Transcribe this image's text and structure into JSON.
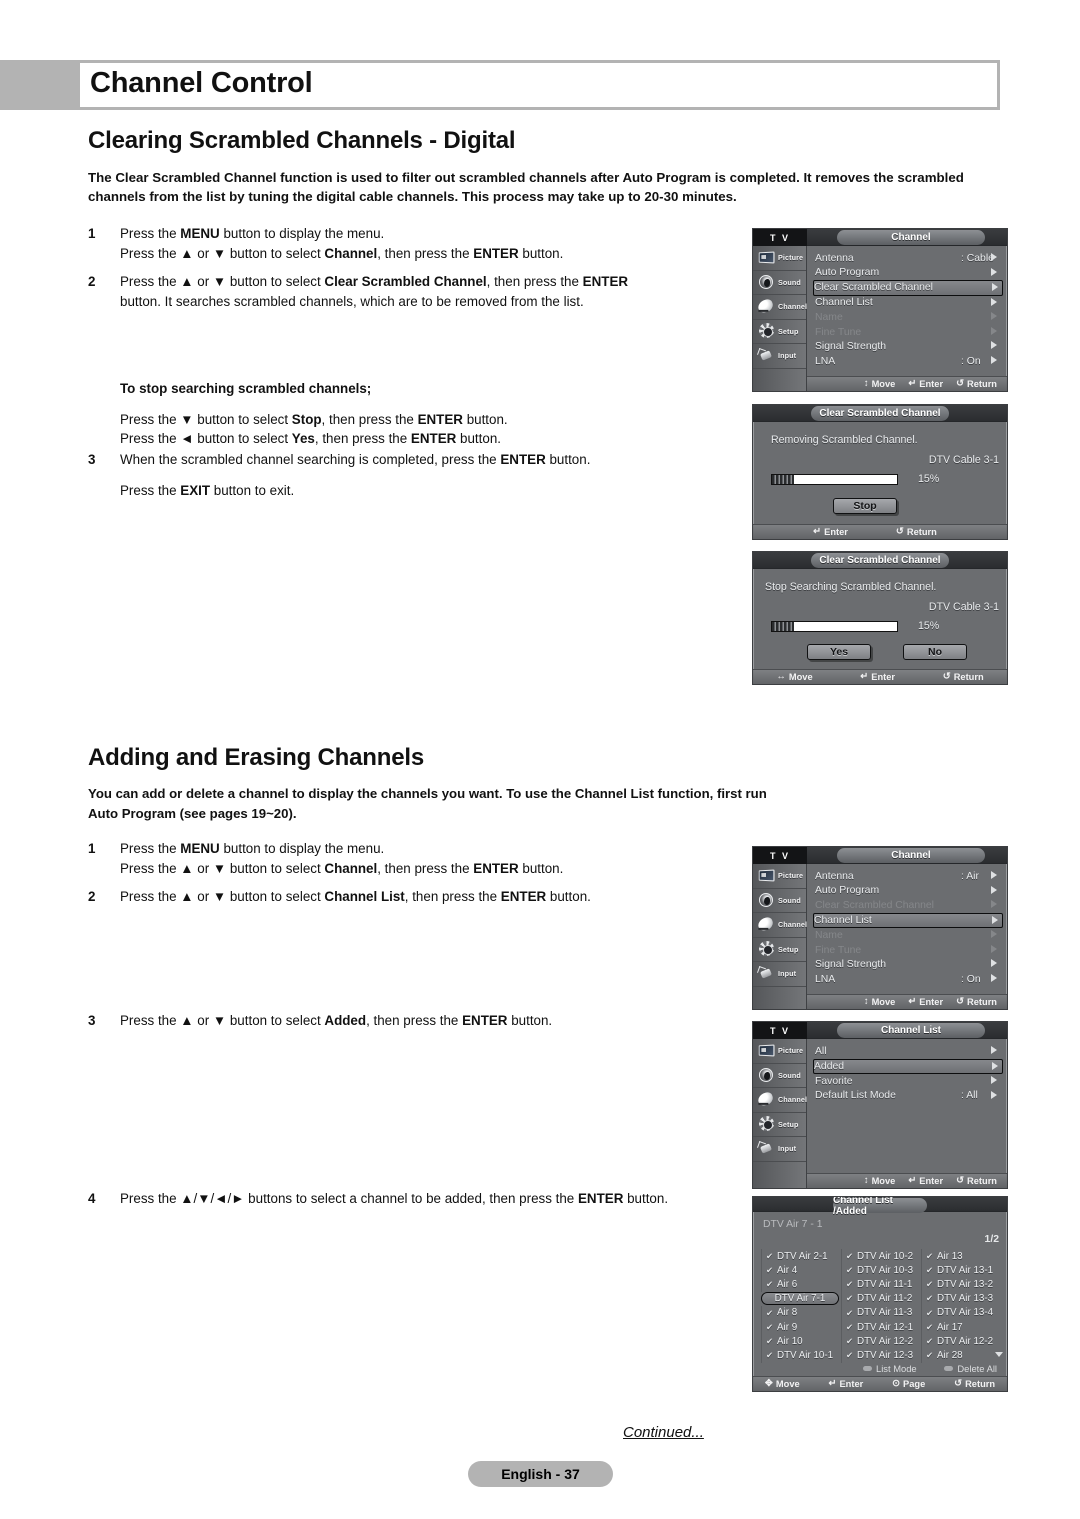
{
  "header": {
    "title": "Channel Control"
  },
  "section1": {
    "heading": "Clearing Scrambled Channels - Digital",
    "intro_line1": "The Clear Scrambled Channel function is used to filter out scrambled channels after Auto Program is completed. It removes the",
    "intro_line2": "scrambled channels from the list by tuning the digital cable channels. This process may take up to 20-30 minutes.",
    "steps": [
      {
        "num": "1",
        "line1_a": "Press the ",
        "line1_b": "MENU",
        "line1_c": " button to display the menu.",
        "line2_a": "Press the ▲ or ▼ button to select ",
        "line2_b": "Channel",
        "line2_c": ", then press the ",
        "line2_d": "ENTER",
        "line2_e": " button."
      },
      {
        "num": "2",
        "line1_a": "Press the ▲ or ▼ button to select ",
        "line1_b": "Clear Scrambled Channel",
        "line1_c": ", then press the ",
        "line1_d": "ENTER",
        "line2_a": "button. It searches scrambled channels, which are to be removed from the list."
      }
    ],
    "substep": {
      "heading": "To stop searching scrambled channels;",
      "line1_a": "Press the ▼ button to select ",
      "line1_b": "Stop",
      "line1_c": ", then press the ",
      "line1_d": "ENTER",
      "line1_e": " button.",
      "line2_a": "Press the ◄ button to select ",
      "line2_b": "Yes",
      "line2_c": ", then press the  ",
      "line2_d": "ENTER",
      "line2_e": " button."
    },
    "step3": {
      "num": "3",
      "a": "When the scrambled channel searching is completed, press the ",
      "b": "ENTER",
      "c": " button."
    },
    "exit": {
      "a": "Press the ",
      "b": "EXIT",
      "c": " button to exit."
    }
  },
  "section2": {
    "heading": "Adding and Erasing Channels",
    "intro_line1": "You can add or delete a channel to display the channels you want.",
    "intro_line2": "To use the Channel List function, first run Auto Program (see pages 19~20).",
    "steps": [
      {
        "num": "1",
        "line1_a": "Press the ",
        "line1_b": "MENU",
        "line1_c": " button to display the menu.",
        "line2_a": "Press the ▲ or ▼ button to select ",
        "line2_b": "Channel",
        "line2_c": ", then press the ",
        "line2_d": "ENTER",
        "line2_e": " button."
      },
      {
        "num": "2",
        "line1_a": "Press the ▲ or ▼ button to select ",
        "line1_b": "Channel List",
        "line1_c": ", then press the ",
        "line1_d": "ENTER",
        "line1_e": " button."
      },
      {
        "num": "3",
        "line1_a": "Press the ▲ or ▼ button to select ",
        "line1_b": "Added",
        "line1_c": ", then press the ",
        "line1_d": "ENTER",
        "line1_e": " button."
      },
      {
        "num": "4",
        "line1_a": "Press the ▲/▼/◄/► buttons to select a channel to be added, then press the ",
        "line1_b": "ENTER",
        "line1_c": " button."
      }
    ]
  },
  "footer": {
    "continued": "Continued...",
    "page": "English - 37"
  },
  "osd_common": {
    "tv_tab": "T V",
    "sidebar": [
      {
        "label": "Picture",
        "icon": "tv-picture-icon"
      },
      {
        "label": "Sound",
        "icon": "speaker-sound-icon"
      },
      {
        "label": "Channel",
        "icon": "satellite-dish-icon"
      },
      {
        "label": "Setup",
        "icon": "gear-setup-icon"
      },
      {
        "label": "Input",
        "icon": "plug-input-icon"
      }
    ],
    "foot_move": "Move",
    "foot_enter": "Enter",
    "foot_return": "Return",
    "foot_page": "Page"
  },
  "osd_channel_cable": {
    "title": "Channel",
    "rows": [
      {
        "label": "Antenna",
        "value": ": Cable",
        "state": "normal"
      },
      {
        "label": "Auto Program",
        "value": "",
        "state": "normal"
      },
      {
        "label": "Clear Scrambled Channel",
        "value": "",
        "state": "selected"
      },
      {
        "label": "Channel List",
        "value": "",
        "state": "normal"
      },
      {
        "label": "Name",
        "value": "",
        "state": "dim"
      },
      {
        "label": "Fine Tune",
        "value": "",
        "state": "dim"
      },
      {
        "label": "Signal Strength",
        "value": "",
        "state": "normal"
      },
      {
        "label": "LNA",
        "value": ": On",
        "state": "normal"
      }
    ]
  },
  "osd_removing": {
    "title": "Clear Scrambled Channel",
    "message": "Removing Scrambled Channel.",
    "channel": "DTV Cable 3-1",
    "percent": "15%",
    "progress": 15,
    "button": "Stop"
  },
  "osd_stop_search": {
    "title": "Clear Scrambled Channel",
    "message": "Stop Searching Scrambled Channel.",
    "channel": "DTV Cable 3-1",
    "percent": "15%",
    "progress": 15,
    "yes": "Yes",
    "no": "No"
  },
  "osd_channel_air": {
    "title": "Channel",
    "rows": [
      {
        "label": "Antenna",
        "value": ": Air",
        "state": "normal"
      },
      {
        "label": "Auto Program",
        "value": "",
        "state": "normal"
      },
      {
        "label": "Clear Scrambled Channel",
        "value": "",
        "state": "dim"
      },
      {
        "label": "Channel List",
        "value": "",
        "state": "selected"
      },
      {
        "label": "Name",
        "value": "",
        "state": "dim"
      },
      {
        "label": "Fine Tune",
        "value": "",
        "state": "dim"
      },
      {
        "label": "Signal Strength",
        "value": "",
        "state": "normal"
      },
      {
        "label": "LNA",
        "value": ": On",
        "state": "normal"
      }
    ]
  },
  "osd_channel_list": {
    "title": "Channel List",
    "rows": [
      {
        "label": "All",
        "value": "",
        "state": "normal"
      },
      {
        "label": "Added",
        "value": "",
        "state": "selected"
      },
      {
        "label": "Favorite",
        "value": "",
        "state": "normal"
      },
      {
        "label": "Default List Mode",
        "value": ": All",
        "state": "normal"
      }
    ]
  },
  "osd_channel_grid": {
    "title": "Channel List /Added",
    "current_channel": "DTV Air 7 - 1",
    "page": "1/2",
    "cells": [
      {
        "label": "DTV Air 2-1",
        "checked": true,
        "selected": false
      },
      {
        "label": "DTV Air 10-2",
        "checked": true,
        "selected": false
      },
      {
        "label": "Air 13",
        "checked": true,
        "selected": false
      },
      {
        "label": "Air 4",
        "checked": true,
        "selected": false
      },
      {
        "label": "DTV Air 10-3",
        "checked": true,
        "selected": false
      },
      {
        "label": "DTV Air 13-1",
        "checked": true,
        "selected": false
      },
      {
        "label": "Air 6",
        "checked": true,
        "selected": false
      },
      {
        "label": "DTV Air 11-1",
        "checked": true,
        "selected": false
      },
      {
        "label": "DTV Air 13-2",
        "checked": true,
        "selected": false
      },
      {
        "label": "DTV Air 7-1",
        "checked": false,
        "selected": true
      },
      {
        "label": "DTV Air 11-2",
        "checked": true,
        "selected": false
      },
      {
        "label": "DTV Air 13-3",
        "checked": true,
        "selected": false
      },
      {
        "label": "Air 8",
        "checked": true,
        "selected": false
      },
      {
        "label": "DTV Air 11-3",
        "checked": true,
        "selected": false
      },
      {
        "label": "DTV Air 13-4",
        "checked": true,
        "selected": false
      },
      {
        "label": "Air 9",
        "checked": true,
        "selected": false
      },
      {
        "label": "DTV Air 12-1",
        "checked": true,
        "selected": false
      },
      {
        "label": "Air 17",
        "checked": true,
        "selected": false
      },
      {
        "label": "Air 10",
        "checked": true,
        "selected": false
      },
      {
        "label": "DTV Air 12-2",
        "checked": true,
        "selected": false
      },
      {
        "label": "DTV Air 12-2",
        "checked": true,
        "selected": false
      },
      {
        "label": "DTV Air 10-1",
        "checked": true,
        "selected": false
      },
      {
        "label": "DTV Air 12-3",
        "checked": true,
        "selected": false
      },
      {
        "label": "Air 28",
        "checked": true,
        "selected": false
      }
    ],
    "list_mode": "List Mode",
    "delete_all": "Delete All"
  },
  "glyphs": {
    "updown": "↕",
    "leftright": "↔",
    "fourway": "✥",
    "enter": "↵",
    "return": "↺",
    "page": "⊙",
    "check": "✔"
  },
  "colors": {
    "header_bar": "#b3b3b3",
    "osd_bg": "#6b6d70",
    "osd_title": "#8d9094",
    "page_pill": "#b3b3b3"
  }
}
